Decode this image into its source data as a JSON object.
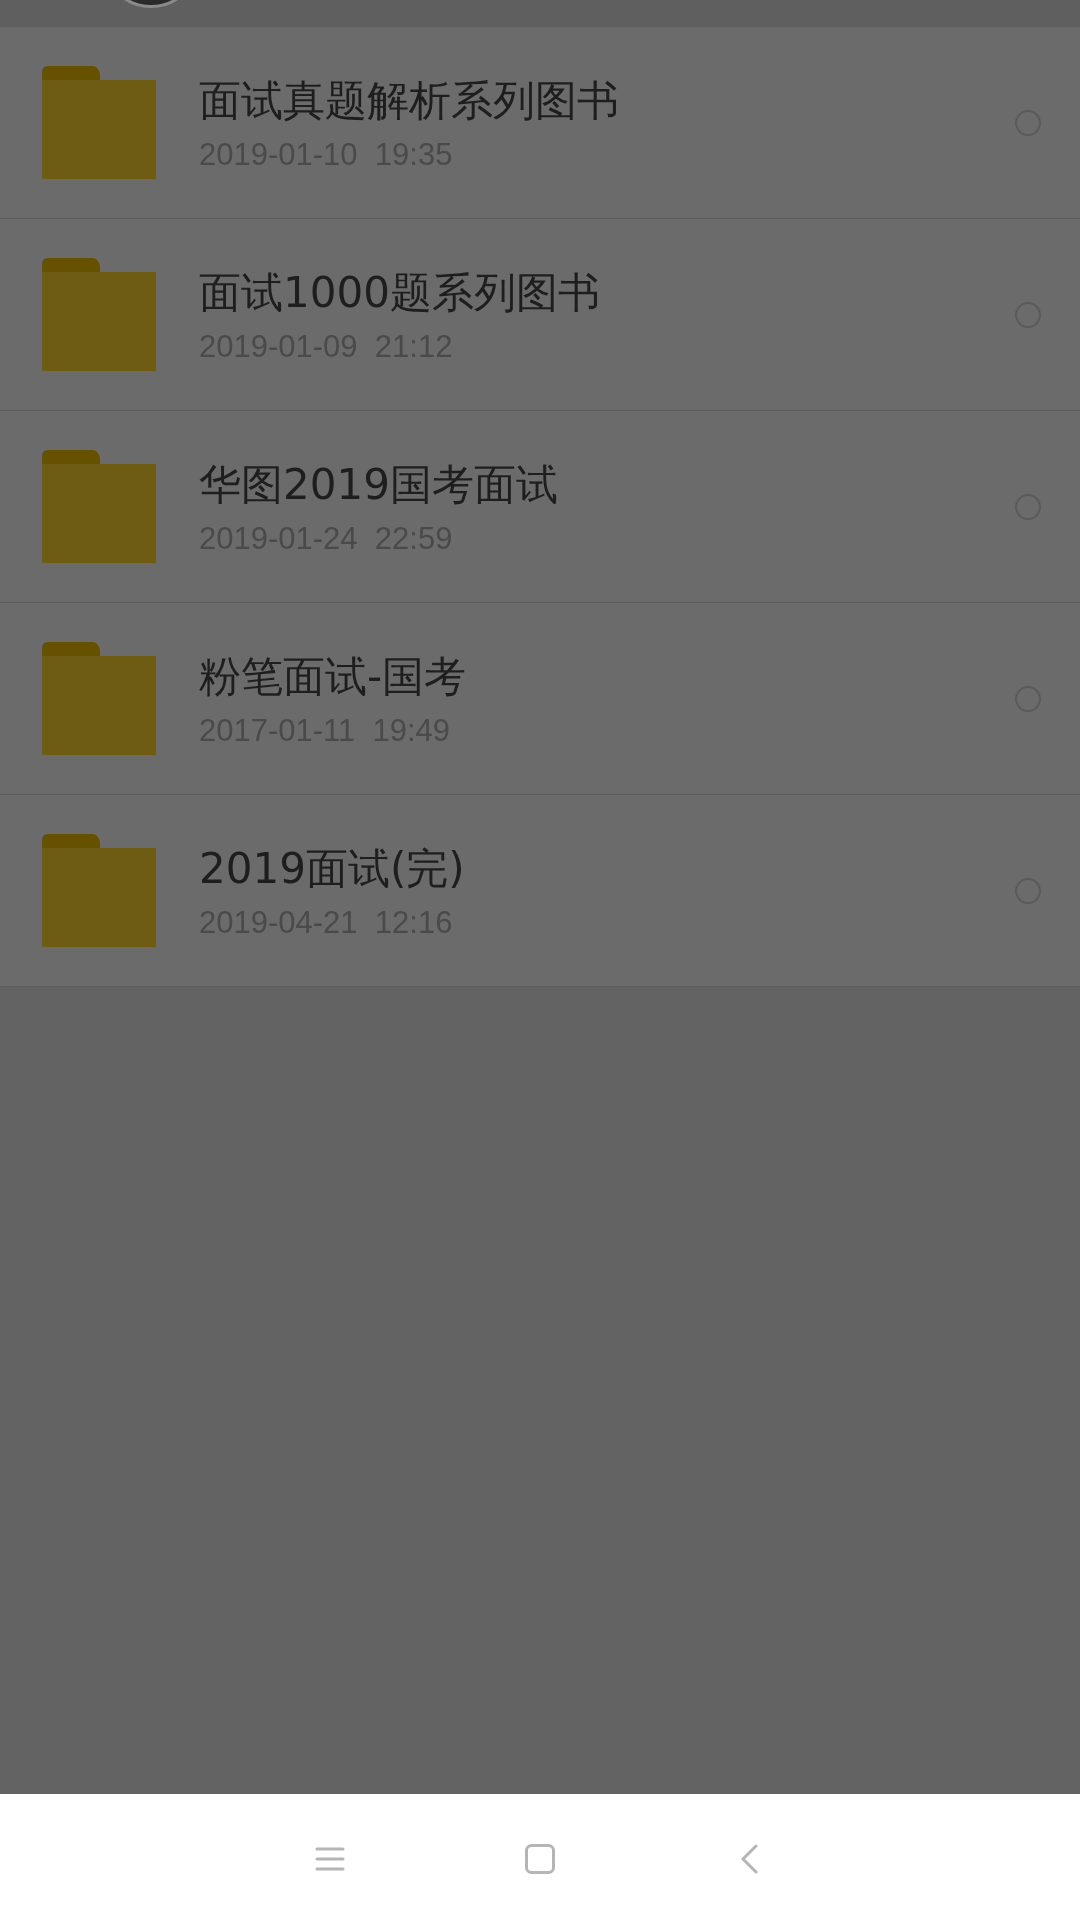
{
  "files": [
    {
      "name": "面试真题解析系列图书",
      "date": "2019-01-10  19:35",
      "selected": false
    },
    {
      "name": "面试1000题系列图书",
      "date": "2019-01-09  21:12",
      "selected": false
    },
    {
      "name": "华图2019国考面试",
      "date": "2019-01-24  22:59",
      "selected": false
    },
    {
      "name": "粉笔面试-国考",
      "date": "2017-01-11  19:49",
      "selected": false
    },
    {
      "name": "2019面试(完)",
      "date": "2019-04-21  12:16",
      "selected": false
    }
  ]
}
